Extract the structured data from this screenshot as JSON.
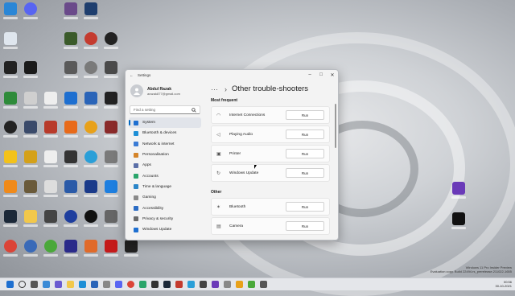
{
  "window": {
    "title": "Settings",
    "user": {
      "name": "Abdul Razak",
      "email": "arazak877@gmail.com"
    },
    "search_placeholder": "Find a setting",
    "nav": [
      {
        "label": "System",
        "color": "#1e6fd0",
        "selected": true
      },
      {
        "label": "Bluetooth & devices",
        "color": "#1e8fd6"
      },
      {
        "label": "Network & internet",
        "color": "#3a7bd5"
      },
      {
        "label": "Personalisation",
        "color": "#d4842a"
      },
      {
        "label": "Apps",
        "color": "#5b6fa8"
      },
      {
        "label": "Accounts",
        "color": "#2aa56b"
      },
      {
        "label": "Time & language",
        "color": "#2b86c9"
      },
      {
        "label": "Gaming",
        "color": "#8a8a8a"
      },
      {
        "label": "Accessibility",
        "color": "#2b6cc4"
      },
      {
        "label": "Privacy & security",
        "color": "#6b6b6b"
      },
      {
        "label": "Windows Update",
        "color": "#1e6fd0"
      }
    ],
    "breadcrumb_dots": "···",
    "page_title": "Other trouble-shooters",
    "sections": [
      {
        "header": "Most frequent",
        "items": [
          {
            "label": "Internet Connections",
            "icon": "wifi-icon",
            "glyph": "◠",
            "button": "Run"
          },
          {
            "label": "Playing Audio",
            "icon": "speaker-icon",
            "glyph": "◁",
            "button": "Run"
          },
          {
            "label": "Printer",
            "icon": "printer-icon",
            "glyph": "▣",
            "button": "Run"
          },
          {
            "label": "Windows Update",
            "icon": "refresh-icon",
            "glyph": "↻",
            "button": "Run"
          }
        ]
      },
      {
        "header": "Other",
        "items": [
          {
            "label": "Bluetooth",
            "icon": "bluetooth-icon",
            "glyph": "✶",
            "button": "Run"
          },
          {
            "label": "Camera",
            "icon": "camera-icon",
            "glyph": "▤",
            "button": "Run"
          }
        ]
      }
    ]
  },
  "taskbar": {
    "clock_time": "00:56",
    "clock_date": "30-10-2021"
  },
  "watermark": {
    "line1": "Windows 11 Pro Insider Preview",
    "line2": "Evaluation copy. Build 22494.rs_prerelease.211022-1655"
  },
  "colors": {
    "accent": "#0067c0"
  }
}
